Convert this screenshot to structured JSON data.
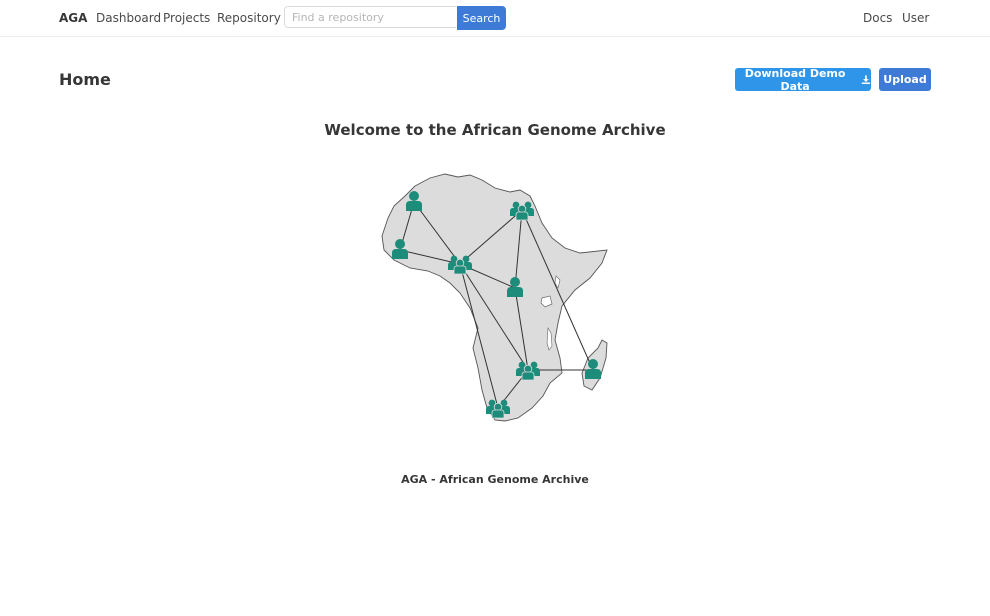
{
  "navbar": {
    "brand": "AGA",
    "links": [
      "Dashboard",
      "Projects",
      "Repository"
    ],
    "search": {
      "placeholder": "Find a repository",
      "value": "",
      "button_label": "Search"
    },
    "right_links": [
      "Docs",
      "User"
    ]
  },
  "header": {
    "title": "Home",
    "download_label": "Download Demo Data",
    "download_icon": "download-icon",
    "upload_label": "Upload"
  },
  "main": {
    "welcome": "Welcome to the African Genome Archive",
    "map_icon": "africa-network-map",
    "footer_caption": "AGA - African Genome Archive"
  },
  "colors": {
    "primary": "#3e7bd6",
    "info": "#2f95e8",
    "person": "#1e8c7a",
    "land": "#dcdcdc"
  }
}
